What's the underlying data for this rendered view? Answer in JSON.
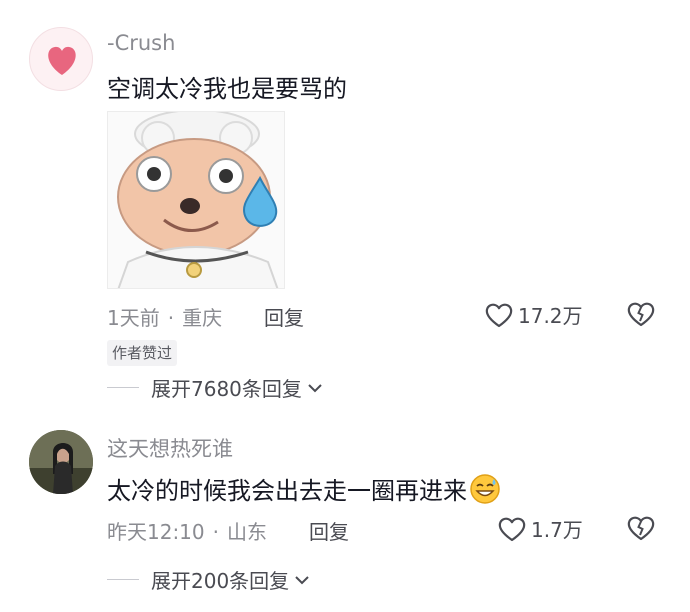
{
  "comments": [
    {
      "username": "-Crush",
      "text": "空调太冷我也是要骂的",
      "time": "1天前",
      "location": "重庆",
      "reply_label": "回复",
      "likes": "17.2万",
      "badge": "作者赞过",
      "expand_label": "展开7680条回复",
      "avatar_icon": "pink-heart-icon",
      "sticker_icon": "sheep-sweat-sticker"
    },
    {
      "username": "这天想热死谁",
      "text": "太冷的时候我会出去走一圈再进来",
      "time": "昨天12:10",
      "location": "山东",
      "reply_label": "回复",
      "likes": "1.7万",
      "expand_label": "展开200条回复",
      "avatar_icon": "user-photo-avatar",
      "emoji": "grinning-sweat-emoji"
    }
  ],
  "colors": {
    "text_primary": "#161823",
    "text_secondary": "#8a8b91",
    "heart_pink": "#e8667f"
  }
}
